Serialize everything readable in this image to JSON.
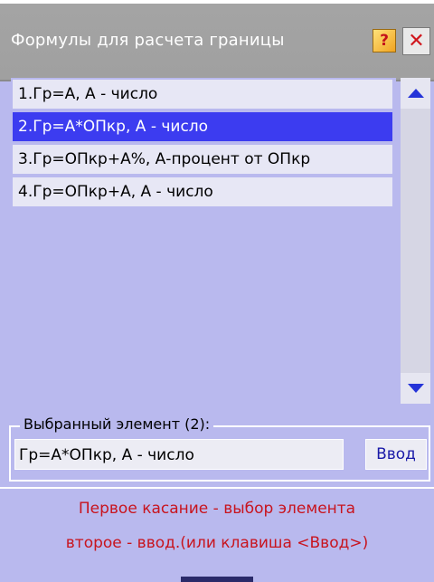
{
  "window": {
    "title": "Формулы для расчета границы",
    "help_glyph": "?",
    "close_glyph": "✕"
  },
  "list": {
    "items": [
      {
        "label": "1.Гр=А, А - число",
        "selected": false
      },
      {
        "label": "2.Гр=А*ОПкр, А - число",
        "selected": true
      },
      {
        "label": "3.Гр=ОПкр+А%, А-процент от ОПкр",
        "selected": false
      },
      {
        "label": "4.Гр=ОПкр+А, А - число",
        "selected": false
      }
    ]
  },
  "selection": {
    "group_label": "Выбранный элемент (2):",
    "value": "Гр=А*ОПкр, А - число",
    "enter_label": "Ввод"
  },
  "hints": {
    "line1": "Первое касание - выбор элемента",
    "line2": "второе - ввод.(или клавиша <Ввод>)"
  },
  "colors": {
    "background": "#b9b9ee",
    "selected_item": "#3c3cf0",
    "hint_text": "#c8141e",
    "scroll_arrow": "#2433d8"
  }
}
